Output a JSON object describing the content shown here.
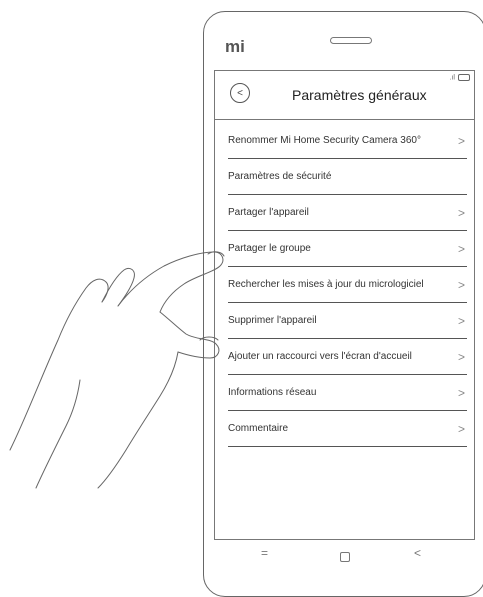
{
  "phone": {
    "brand": "mi",
    "status_signal": ".ıl"
  },
  "header": {
    "title": "Paramètres généraux",
    "back_icon": "back-arrow-icon"
  },
  "menu": {
    "items": [
      {
        "label": "Renommer Mi Home Security Camera 360°",
        "chevron": ">"
      },
      {
        "label": "Paramètres de sécurité",
        "chevron": ""
      },
      {
        "label": "Partager l'appareil",
        "chevron": ">"
      },
      {
        "label": "Partager le groupe",
        "chevron": ">"
      },
      {
        "label": "Rechercher les mises à jour du micrologiciel",
        "chevron": ">"
      },
      {
        "label": "Supprimer l'appareil",
        "chevron": ">"
      },
      {
        "label": "Ajouter un raccourci vers l'écran d'accueil",
        "chevron": ">"
      },
      {
        "label": "Informations réseau",
        "chevron": ">"
      },
      {
        "label": "Commentaire",
        "chevron": ">"
      }
    ]
  },
  "navbar": {
    "menu": "=",
    "back": "<"
  }
}
